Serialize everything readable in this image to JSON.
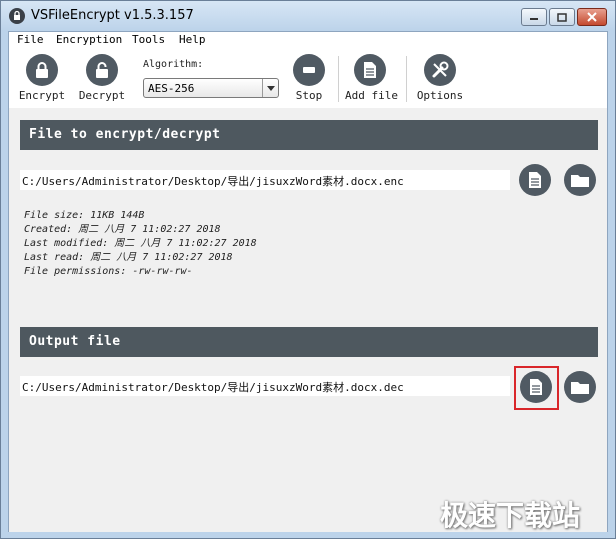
{
  "window": {
    "title": "VSFileEncrypt v1.5.3.157"
  },
  "menu": [
    "File",
    "Encryption",
    "Tools",
    "Help"
  ],
  "toolbar": {
    "encrypt": "Encrypt",
    "decrypt": "Decrypt",
    "algorithm_label": "Algorithm:",
    "algorithm_value": "AES-256",
    "stop": "Stop",
    "add_file": "Add file",
    "options": "Options"
  },
  "input_section": {
    "header": "File to encrypt/decrypt",
    "path": "C:/Users/Administrator/Desktop/导出/jisuxzWord素材.docx.enc",
    "info": [
      "File size: 11KB 144B",
      "Created: 周二 八月 7 11:02:27 2018",
      "Last modified: 周二 八月 7 11:02:27 2018",
      "Last read: 周二 八月 7 11:02:27 2018",
      "File permissions: -rw-rw-rw-"
    ]
  },
  "output_section": {
    "header": "Output file",
    "path": "C:/Users/Administrator/Desktop/导出/jisuxzWord素材.docx.dec"
  },
  "watermark": "极速下载站",
  "colors": {
    "accent_dark": "#505a63",
    "header_bg": "#4e585f",
    "highlight": "#d9262a"
  }
}
